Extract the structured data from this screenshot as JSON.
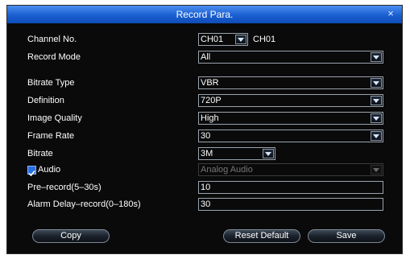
{
  "dialog": {
    "title": "Record Para.",
    "close_label": "×"
  },
  "channel": {
    "label": "Channel No.",
    "value": "CH01",
    "name": "CH01"
  },
  "record_mode": {
    "label": "Record Mode",
    "value": "All"
  },
  "bitrate_type": {
    "label": "Bitrate Type",
    "value": "VBR"
  },
  "definition": {
    "label": "Definition",
    "value": "720P"
  },
  "image_quality": {
    "label": "Image Quality",
    "value": "High"
  },
  "frame_rate": {
    "label": "Frame Rate",
    "value": "30"
  },
  "bitrate": {
    "label": "Bitrate",
    "value": "3M"
  },
  "audio": {
    "label": "Audio",
    "checked": true,
    "value": "Analog Audio"
  },
  "pre_record": {
    "label": "Pre–record(5–30s)",
    "value": "10"
  },
  "alarm_delay": {
    "label": "Alarm Delay–record(0–180s)",
    "value": "30"
  },
  "buttons": {
    "copy": "Copy",
    "reset": "Reset Default",
    "save": "Save"
  }
}
